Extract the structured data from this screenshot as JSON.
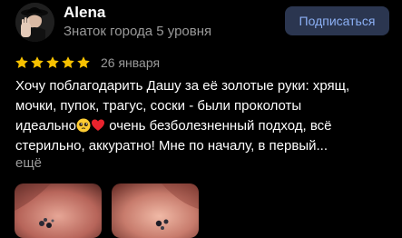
{
  "review": {
    "author": {
      "name": "Alena",
      "rank": "Знаток города 5 уровня",
      "avatar_icon": "avatar-hat-hand-icon"
    },
    "subscribe_label": "Подписаться",
    "rating": 5,
    "date": "26 января",
    "text_lines": [
      "Хочу поблагодарить Дашу за её золотые руки: хрящ,",
      "мочки, пупок, трагус, соски - были проколоты",
      "идеально",
      "очень безболезненный подход, всё",
      "стерильно, аккуратно! Мне по началу, в первый..."
    ],
    "emojis": [
      "pleading-face-icon",
      "red-heart-icon"
    ],
    "more_label": "ещё",
    "photos": [
      "ear-piercing-photo-1",
      "ear-piercing-photo-2"
    ]
  },
  "colors": {
    "background": "#000000",
    "star": "#f7c100",
    "subscribe_bg": "#2b3650",
    "subscribe_text": "#8cb0f5",
    "secondary_text": "#9a9a9a"
  }
}
